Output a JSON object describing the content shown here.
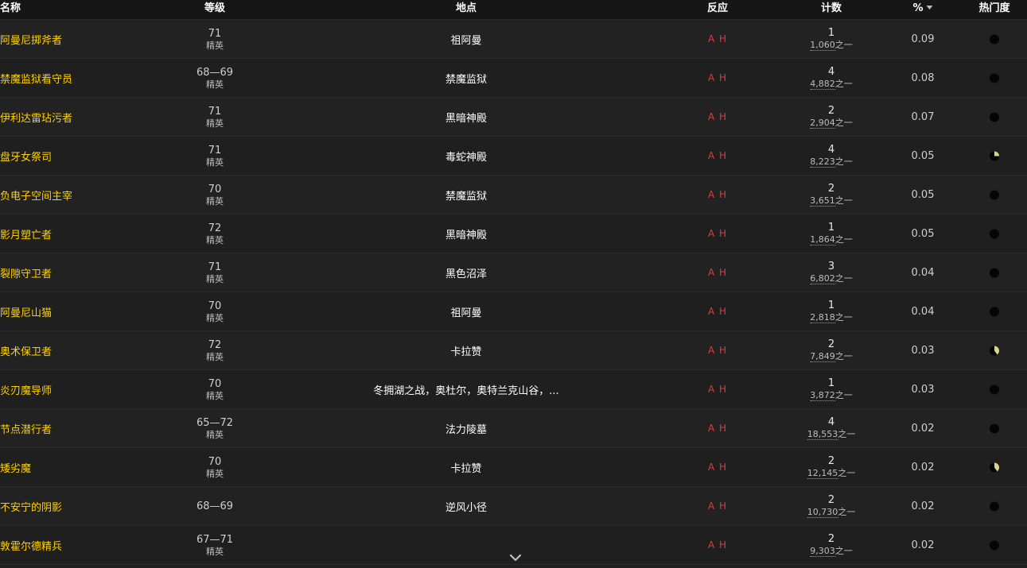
{
  "header": {
    "name": "名称",
    "level": "等级",
    "location": "地点",
    "reaction": "反应",
    "count": "计数",
    "percent": "%",
    "popularity": "热门度"
  },
  "reaction_a": "A",
  "reaction_h": "H",
  "count_suffix": "之一",
  "colors": {
    "name": "#ffd100",
    "reaction": "#e23a3a",
    "pie_fill": "#d8d48a"
  },
  "rows": [
    {
      "name": "阿曼尼掷斧者",
      "level": "71",
      "level_tag": "精英",
      "location": "祖阿曼",
      "count": "1",
      "total": "1,060",
      "percent": "0.09",
      "popularity": 0
    },
    {
      "name": "禁魔监狱看守员",
      "level": "68—69",
      "level_tag": "精英",
      "location": "禁魔监狱",
      "count": "4",
      "total": "4,882",
      "percent": "0.08",
      "popularity": 0
    },
    {
      "name": "伊利达雷玷污者",
      "level": "71",
      "level_tag": "精英",
      "location": "黑暗神殿",
      "count": "2",
      "total": "2,904",
      "percent": "0.07",
      "popularity": 0
    },
    {
      "name": "盘牙女祭司",
      "level": "71",
      "level_tag": "精英",
      "location": "毒蛇神殿",
      "count": "4",
      "total": "8,223",
      "percent": "0.05",
      "popularity": 0.25
    },
    {
      "name": "负电子空间主宰",
      "level": "70",
      "level_tag": "精英",
      "location": "禁魔监狱",
      "count": "2",
      "total": "3,651",
      "percent": "0.05",
      "popularity": 0
    },
    {
      "name": "影月塑亡者",
      "level": "72",
      "level_tag": "精英",
      "location": "黑暗神殿",
      "count": "1",
      "total": "1,864",
      "percent": "0.05",
      "popularity": 0
    },
    {
      "name": "裂隙守卫者",
      "level": "71",
      "level_tag": "精英",
      "location": "黑色沼泽",
      "count": "3",
      "total": "6,802",
      "percent": "0.04",
      "popularity": 0
    },
    {
      "name": "阿曼尼山猫",
      "level": "70",
      "level_tag": "精英",
      "location": "祖阿曼",
      "count": "1",
      "total": "2,818",
      "percent": "0.04",
      "popularity": 0
    },
    {
      "name": "奥术保卫者",
      "level": "72",
      "level_tag": "精英",
      "location": "卡拉赞",
      "count": "2",
      "total": "7,849",
      "percent": "0.03",
      "popularity": 0.4
    },
    {
      "name": "炎刃魔导师",
      "level": "70",
      "level_tag": "精英",
      "location": "冬拥湖之战，奥杜尔，奥特兰克山谷，...",
      "count": "1",
      "total": "3,872",
      "percent": "0.03",
      "popularity": 0
    },
    {
      "name": "节点潜行者",
      "level": "65—72",
      "level_tag": "精英",
      "location": "法力陵墓",
      "count": "4",
      "total": "18,553",
      "percent": "0.02",
      "popularity": 0
    },
    {
      "name": "矮劣魔",
      "level": "70",
      "level_tag": "精英",
      "location": "卡拉赞",
      "count": "2",
      "total": "12,145",
      "percent": "0.02",
      "popularity": 0.4
    },
    {
      "name": "不安宁的阴影",
      "level": "68—69",
      "level_tag": "",
      "location": "逆风小径",
      "count": "2",
      "total": "10,730",
      "percent": "0.02",
      "popularity": 0
    },
    {
      "name": "敦霍尔德精兵",
      "level": "67—71",
      "level_tag": "精英",
      "location": "",
      "count": "2",
      "total": "9,303",
      "percent": "0.02",
      "popularity": 0
    }
  ]
}
